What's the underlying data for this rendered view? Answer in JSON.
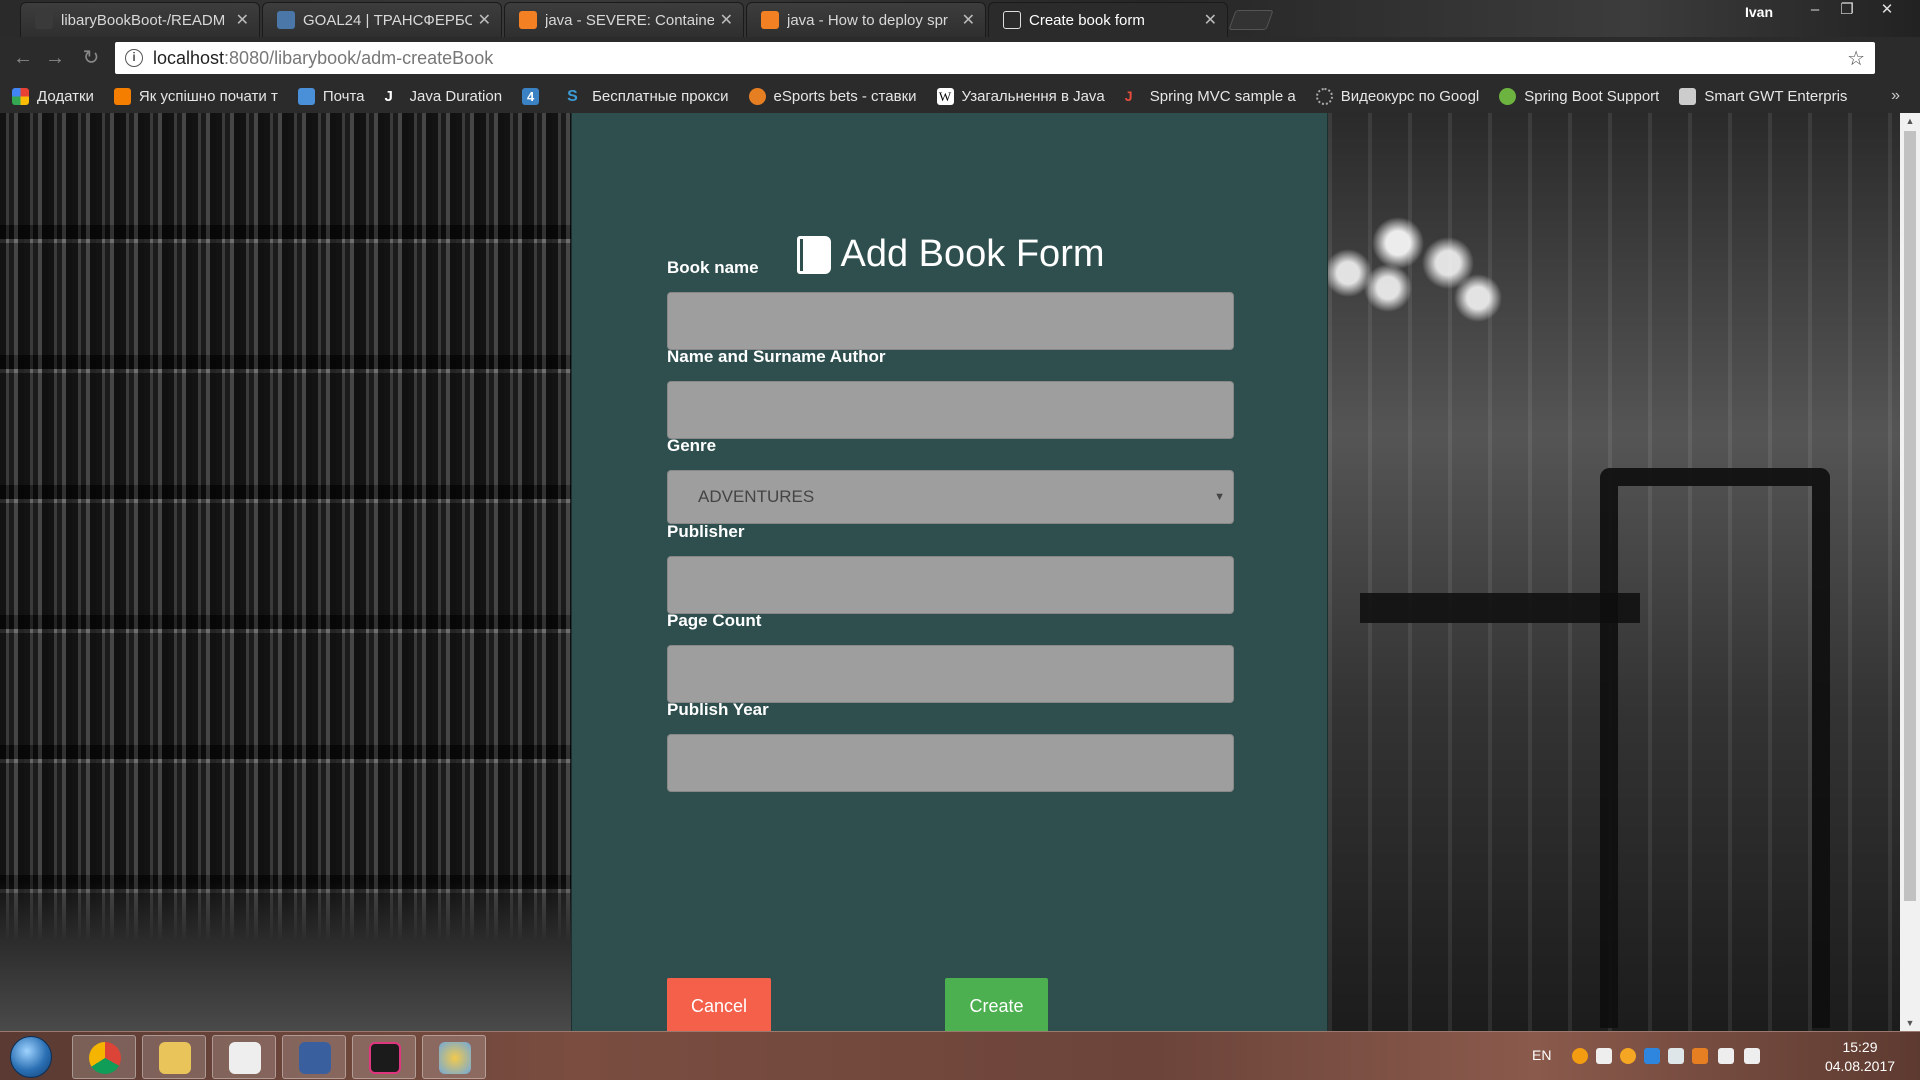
{
  "browser": {
    "tabs": [
      {
        "title": "libaryBookBoot-/READM",
        "favicon_color": "#3a3a3a",
        "active": false
      },
      {
        "title": "GOAL24 | ТРАНСФЕРБО",
        "favicon_color": "#4a76a8",
        "active": false
      },
      {
        "title": "java - SEVERE: Container",
        "favicon_color": "#f48024",
        "active": false
      },
      {
        "title": "java - How to deploy spr",
        "favicon_color": "#f48024",
        "active": false
      },
      {
        "title": "Create book form",
        "favicon_color": "#ffffff",
        "active": true
      }
    ],
    "profile_name": "Ivan",
    "url_host": "localhost",
    "url_path": ":8080/libarybook/adm-createBook",
    "bookmarks": [
      {
        "label": "Додатки",
        "icon": "apps-icon",
        "color": "#e94235"
      },
      {
        "label": "Як успішно почати т",
        "icon": "blogger-icon",
        "color": "#f57d00"
      },
      {
        "label": "Почта",
        "icon": "mail-icon",
        "color": "#4a90d9"
      },
      {
        "label": "Java Duration",
        "icon": "j-icon",
        "color": "#ffffff"
      },
      {
        "label": "",
        "icon": "four-icon",
        "color": "#3b82c4"
      },
      {
        "label": "Бесплатные прокси",
        "icon": "s-icon",
        "color": "#3b9bd8"
      },
      {
        "label": "eSports bets - ставки",
        "icon": "esports-icon",
        "color": "#e67e22"
      },
      {
        "label": "Узагальнення в Java",
        "icon": "wikipedia-icon",
        "color": "#ffffff"
      },
      {
        "label": "Spring MVC sample a",
        "icon": "spring-mvc-icon",
        "color": "#e74c3c"
      },
      {
        "label": "Видеокурс по Googl",
        "icon": "loader-icon",
        "color": "#aaaaaa"
      },
      {
        "label": "Spring Boot Support",
        "icon": "spring-icon",
        "color": "#6db33f"
      },
      {
        "label": "Smart GWT Enterpris",
        "icon": "gwt-icon",
        "color": "#cccccc"
      }
    ]
  },
  "form": {
    "title": "Add Book Form",
    "book_name_label": "Book name",
    "author_label": "Name and Surname Author",
    "genre_label": "Genre",
    "genre_selected": "ADVENTURES",
    "publisher_label": "Publisher",
    "page_count_label": "Page Count",
    "publish_year_label": "Publish Year",
    "cancel_label": "Cancel",
    "create_label": "Create",
    "panel_color": "#2f4f4f",
    "cancel_color": "#f4604a",
    "create_color": "#4caf50"
  },
  "taskbar": {
    "language": "EN",
    "time": "15:29",
    "date": "04.08.2017",
    "apps": [
      "chrome-icon",
      "explorer-icon",
      "visual-studio-code-icon",
      "visual-studio-icon",
      "intellij-icon",
      "paint-icon"
    ]
  }
}
